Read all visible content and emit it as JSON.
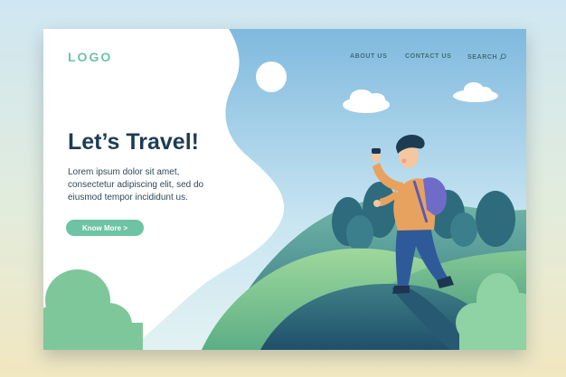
{
  "header": {
    "logo": "LOGO",
    "nav": [
      {
        "label": "ABOUT US"
      },
      {
        "label": "CONTACT US"
      },
      {
        "label": "SEARCH"
      }
    ]
  },
  "hero": {
    "headline": "Let’s Travel!",
    "body": "Lorem ipsum dolor sit amet, consectetur adipiscing elit, sed do eiusmod tempor incididunt us.",
    "cta_label": "Know More >"
  },
  "icons": {
    "search": "search-icon"
  },
  "colors": {
    "accent": "#6dc3a4",
    "headline": "#1d3c53",
    "nav": "#3f6d72",
    "sky": "#a8d3ea"
  }
}
